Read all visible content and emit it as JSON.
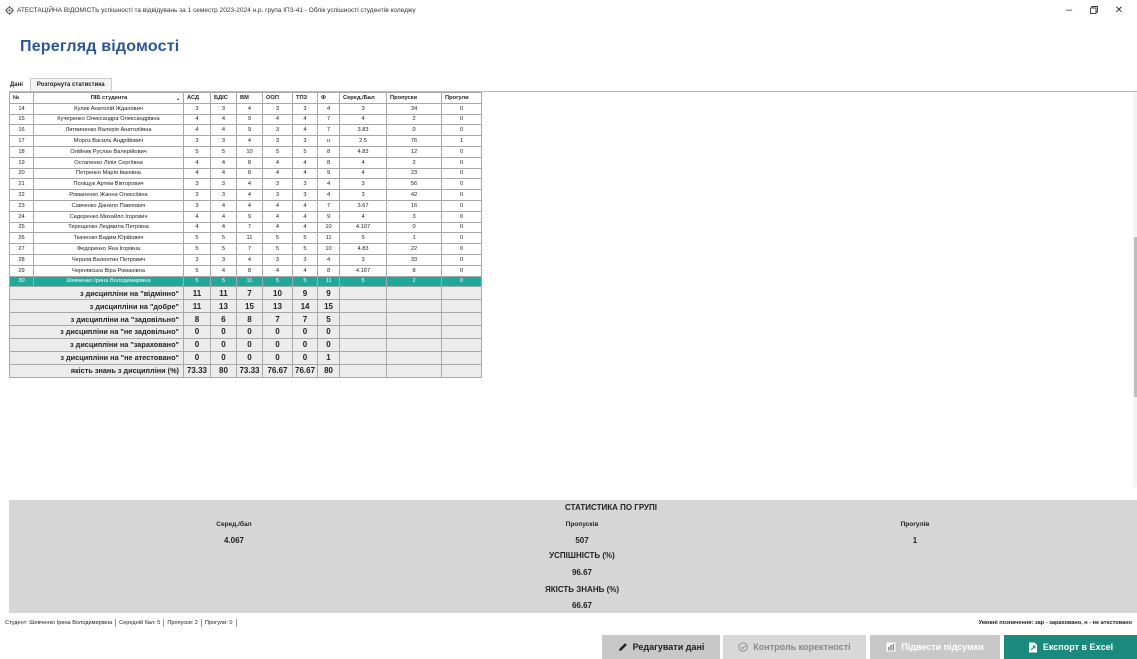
{
  "window": {
    "title": "АТЕСТАЦІЙНА ВІДОМІСТЬ успішності та відвідувань за 1 семестр 2023-2024 н.р. група ІПЗ-41 - Облік успішності студентів коледжу",
    "min": "–",
    "max": "▢",
    "close": "✕"
  },
  "page_title": "Перегляд відомості",
  "tabs": [
    "Дані",
    "Розгорнута статистика"
  ],
  "columns": [
    "№",
    "ПІБ студента",
    "АСД",
    "БДІС",
    "ВМ",
    "ООП",
    "ТПЗ",
    "Ф",
    "Серед./Бал",
    "Пропуски",
    "Прогули"
  ],
  "sort_glyph": "▲",
  "rows": [
    [
      "14",
      "Кулик Анатолій Жданович",
      "3",
      "3",
      "4",
      "3",
      "3",
      "4",
      "3",
      "34",
      "0"
    ],
    [
      "15",
      "Кучеренко Олександра Олександрівна",
      "4",
      "4",
      "9",
      "4",
      "4",
      "7",
      "4",
      "2",
      "0"
    ],
    [
      "16",
      "Литвиненко Валерія Анатоліївна",
      "4",
      "4",
      "9",
      "3",
      "4",
      "7",
      "3.83",
      "0",
      "0"
    ],
    [
      "17",
      "Мороз Василь Андрійович",
      "3",
      "3",
      "4",
      "3",
      "3",
      "н",
      "2.5",
      "76",
      "1"
    ],
    [
      "18",
      "Олійник Руслан Валерійович",
      "5",
      "5",
      "10",
      "5",
      "5",
      "8",
      "4.83",
      "12",
      "0"
    ],
    [
      "19",
      "Остапенко Лілія Сергіївна",
      "4",
      "4",
      "8",
      "4",
      "4",
      "8",
      "4",
      "2",
      "0"
    ],
    [
      "20",
      "Петренко Марія Іванівна",
      "4",
      "4",
      "8",
      "4",
      "4",
      "9",
      "4",
      "23",
      "0"
    ],
    [
      "21",
      "Поліщук Артем Вікторович",
      "3",
      "3",
      "4",
      "3",
      "3",
      "4",
      "3",
      "56",
      "0"
    ],
    [
      "22",
      "Романенко Жанна Олексіївна",
      "3",
      "3",
      "4",
      "3",
      "3",
      "4",
      "3",
      "42",
      "0"
    ],
    [
      "23",
      "Савченко Данило Павлович",
      "3",
      "4",
      "4",
      "4",
      "4",
      "7",
      "3.67",
      "16",
      "0"
    ],
    [
      "24",
      "Сидоренко Михайло Ігорович",
      "4",
      "4",
      "9",
      "4",
      "4",
      "9",
      "4",
      "3",
      "0"
    ],
    [
      "25",
      "Терещенко Людмила Петрівна",
      "4",
      "4",
      "7",
      "4",
      "4",
      "10",
      "4.167",
      "0",
      "0"
    ],
    [
      "26",
      "Ткаченко Вадим Юрійович",
      "5",
      "5",
      "11",
      "5",
      "5",
      "11",
      "5",
      "1",
      "0"
    ],
    [
      "27",
      "Федоренко Яна Ігорівна",
      "5",
      "5",
      "7",
      "5",
      "5",
      "10",
      "4.83",
      "22",
      "0"
    ],
    [
      "28",
      "Чернов Валентин Петрович",
      "3",
      "3",
      "4",
      "3",
      "3",
      "4",
      "3",
      "33",
      "0"
    ],
    [
      "29",
      "Чернявська Віра Романівна",
      "5",
      "4",
      "8",
      "4",
      "4",
      "8",
      "4.167",
      "8",
      "0"
    ],
    [
      "30",
      "Шевченко Ірина Володимирівна",
      "5",
      "5",
      "11",
      "5",
      "5",
      "11",
      "5",
      "2",
      "0"
    ]
  ],
  "summary": [
    {
      "label": "з дисципліни на \"відмінно\"",
      "values": [
        "11",
        "11",
        "7",
        "10",
        "9",
        "9"
      ]
    },
    {
      "label": "з дисципліни на \"добре\"",
      "values": [
        "11",
        "13",
        "15",
        "13",
        "14",
        "15"
      ]
    },
    {
      "label": "з дисципліни на \"задовільно\"",
      "values": [
        "8",
        "6",
        "8",
        "7",
        "7",
        "5"
      ]
    },
    {
      "label": "з дисципліни на \"не задовільно\"",
      "values": [
        "0",
        "0",
        "0",
        "0",
        "0",
        "0"
      ]
    },
    {
      "label": "з дисципліни на \"зараховано\"",
      "values": [
        "0",
        "0",
        "0",
        "0",
        "0",
        "0"
      ]
    },
    {
      "label": "з дисципліни на \"не атестовано\"",
      "values": [
        "0",
        "0",
        "0",
        "0",
        "0",
        "1"
      ]
    },
    {
      "label": "якість знань з дисципліни (%)",
      "values": [
        "73.33",
        "80",
        "73.33",
        "76.67",
        "76.67",
        "80"
      ]
    }
  ],
  "stats": {
    "title": "СТАТИСТИКА ПО ГРУПІ",
    "avg_label": "Серед./бал",
    "avg_value": "4.067",
    "absences_label": "Пропусків",
    "absences_value": "507",
    "truancy_label": "Прогулів",
    "truancy_value": "1",
    "success_label": "УСПІШНІСТЬ (%)",
    "success_value": "96.67",
    "quality_label": "ЯКІСТЬ ЗНАНЬ (%)",
    "quality_value": "66.67"
  },
  "status": {
    "student": "Студент: Шевченко Ірина Володимирівна",
    "avg": "Середній бал: 5",
    "absences": "Пропуски: 2",
    "truancy": "Прогули: 0",
    "legend": "Умовні позначення: зар - зараховано, н - не атестовано"
  },
  "buttons": {
    "edit": "Редагувати дані",
    "check": "Контроль коректності",
    "totals": "Підвести підсумки",
    "export": "Експорт в Excel"
  },
  "colors": {
    "title": "#2b5797",
    "selected_row": "#1fa99a",
    "export_button": "#1b8a7e",
    "button_gray": "#c8c8c8"
  }
}
